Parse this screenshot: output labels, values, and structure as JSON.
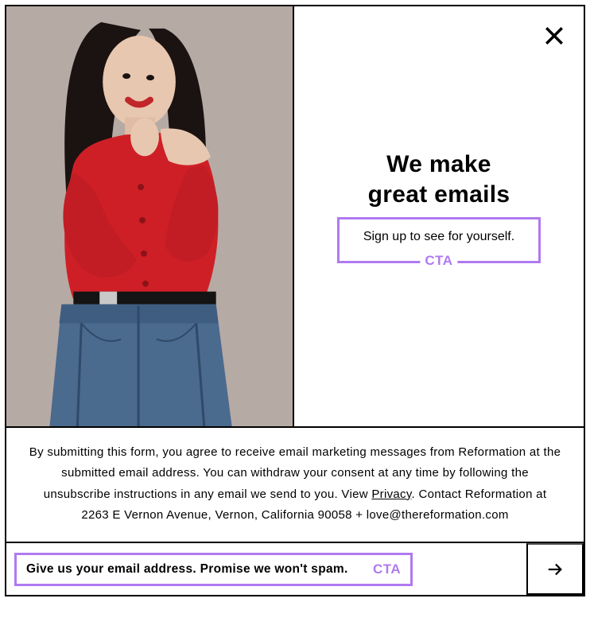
{
  "hero": {
    "headline_line1": "We make",
    "headline_line2": "great emails",
    "subhead": "Sign up to see for yourself.",
    "cta_label": "CTA"
  },
  "legal": {
    "text_prefix": "By submitting this form, you agree to receive email marketing messages from Reformation at the submitted email address. You can withdraw your consent at any time by following the unsubscribe instructions in any email we send to you. View ",
    "privacy_label": "Privacy",
    "text_suffix": ". Contact Reformation at 2263 E Vernon Avenue, Vernon, California 90058 + love@thereformation.com"
  },
  "email_form": {
    "placeholder": "Give us your email address. Promise we won't spam.",
    "cta_label": "CTA"
  }
}
